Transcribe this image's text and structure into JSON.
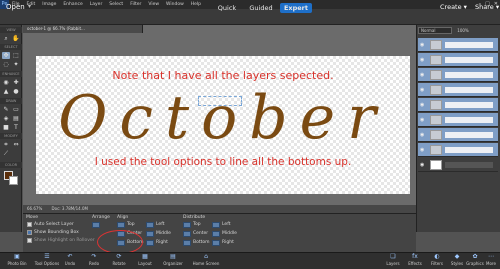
{
  "menubar": {
    "logo": "Pe",
    "items": [
      "File",
      "Edit",
      "Image",
      "Enhance",
      "Layer",
      "Select",
      "Filter",
      "View",
      "Window",
      "Help"
    ],
    "controls": [
      "–",
      "□",
      "✕"
    ]
  },
  "modebar": {
    "open_label": "Open",
    "open_caret": "▾",
    "tabs": [
      "Quick",
      "Guided",
      "Expert"
    ],
    "create_label": "Create ▾",
    "share_label": "Share ▾"
  },
  "toolbox": {
    "sections": [
      "VIEW",
      "SELECT",
      "ENHANCE",
      "DRAW",
      "MODIFY",
      "COLOR"
    ]
  },
  "document": {
    "tab_title": "october-1 @ 66.7% (Rabbit...",
    "zoom": "66.67%",
    "doc_info": "Doc: 3.78M/14.0M"
  },
  "canvas": {
    "note_top": "Note that I have all the layers sepected.",
    "big_word": "October",
    "note_bottom": "I used the tool options to line all the bottoms up."
  },
  "layers": {
    "blend_mode": "Normal",
    "opacity": "100%"
  },
  "options": {
    "move_label": "Move",
    "auto_select": "Auto Select Layer",
    "bounding_box": "Show Bounding Box",
    "highlight": "Show Highlight on Rollover",
    "arrange_label": "Arrange",
    "align_label": "Align",
    "align_buttons": [
      "Top",
      "Center",
      "Bottom",
      "Left",
      "Middle",
      "Right"
    ],
    "distribute_label": "Distribute",
    "distribute_buttons": [
      "Top",
      "Center",
      "Bottom",
      "Left",
      "Middle",
      "Right"
    ]
  },
  "dock": [
    "Photo Bin",
    "Tool Options",
    "Undo",
    "Redo",
    "Rotate",
    "Layout",
    "Organizer",
    "Home Screen",
    "Layers",
    "Effects",
    "Filters",
    "Styles",
    "Graphics",
    "More"
  ]
}
